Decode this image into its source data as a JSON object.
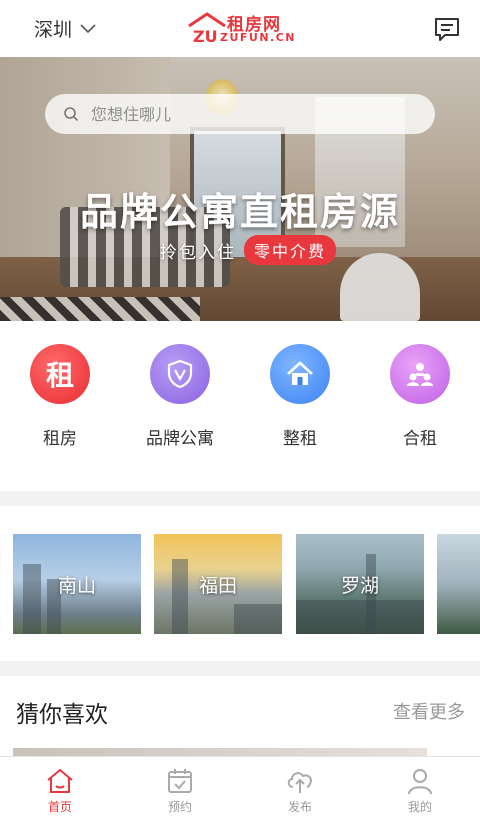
{
  "header": {
    "city": "深圳",
    "logo_cn": "租房网",
    "logo_en": "ZUFUN.CN",
    "logo_mark": "ZU"
  },
  "banner": {
    "search_placeholder": "您想住哪儿",
    "title": "品牌公寓直租房源",
    "sub_left": "拎包入住",
    "sub_badge": "零中介费"
  },
  "categories": [
    {
      "label": "租房",
      "icon": "zu-char-icon",
      "glyph": "租",
      "color": "#e8383d"
    },
    {
      "label": "品牌公寓",
      "icon": "shield-v-icon",
      "color": "#8a63e0"
    },
    {
      "label": "整租",
      "icon": "house-icon",
      "color": "#3c83f2"
    },
    {
      "label": "合租",
      "icon": "people-icon",
      "color": "#c060e6"
    }
  ],
  "districts": [
    {
      "name": "南山"
    },
    {
      "name": "福田"
    },
    {
      "name": "罗湖"
    },
    {
      "name": ""
    }
  ],
  "guess": {
    "title": "猜你喜欢",
    "more": "查看更多"
  },
  "tabs": [
    {
      "label": "首页",
      "icon": "home-icon",
      "active": true
    },
    {
      "label": "预约",
      "icon": "calendar-check-icon",
      "active": false
    },
    {
      "label": "发布",
      "icon": "cloud-upload-icon",
      "active": false
    },
    {
      "label": "我的",
      "icon": "user-icon",
      "active": false
    }
  ],
  "colors": {
    "accent": "#e8383d",
    "inactive": "#999999"
  }
}
